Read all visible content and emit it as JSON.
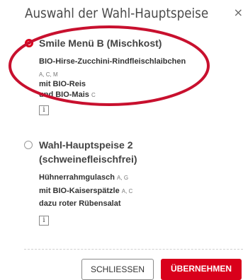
{
  "dialog": {
    "title": "Auswahl der Wahl-Hauptspeise",
    "close_glyph": "×"
  },
  "options": [
    {
      "title_lines": [
        "Smile Menü B (Mischkost)"
      ],
      "selected": true,
      "lines": [
        {
          "text": "BIO-Hirse-Zucchini-Rindfleischlaibchen",
          "allergens": ""
        },
        {
          "text": "",
          "allergens": "A, C, M"
        },
        {
          "text": "mit BIO-Reis",
          "allergens": ""
        },
        {
          "text": "und BIO-Mais",
          "allergens": "C"
        }
      ],
      "info_label": "i"
    },
    {
      "title_lines": [
        "Wahl-Hauptspeise 2",
        "(schweinefleischfrei)"
      ],
      "selected": false,
      "lines": [
        {
          "text": "Hühnerrahmgulasch",
          "allergens": "A, G"
        },
        {
          "text": "mit BIO-Kaiserspätzle",
          "allergens": "A, C"
        },
        {
          "text": "dazu roter Rübensalat",
          "allergens": ""
        }
      ],
      "info_label": "i"
    }
  ],
  "buttons": {
    "close_label": "SCHLIESSEN",
    "apply_label": "ÜBERNEHMEN"
  },
  "colors": {
    "accent": "#d9001b",
    "annotation_ellipse": "#c8102e"
  },
  "icons": {
    "close": "close-icon",
    "info": "info-icon",
    "radio_selected": "radio-selected-icon",
    "radio_unselected": "radio-unselected-icon"
  }
}
